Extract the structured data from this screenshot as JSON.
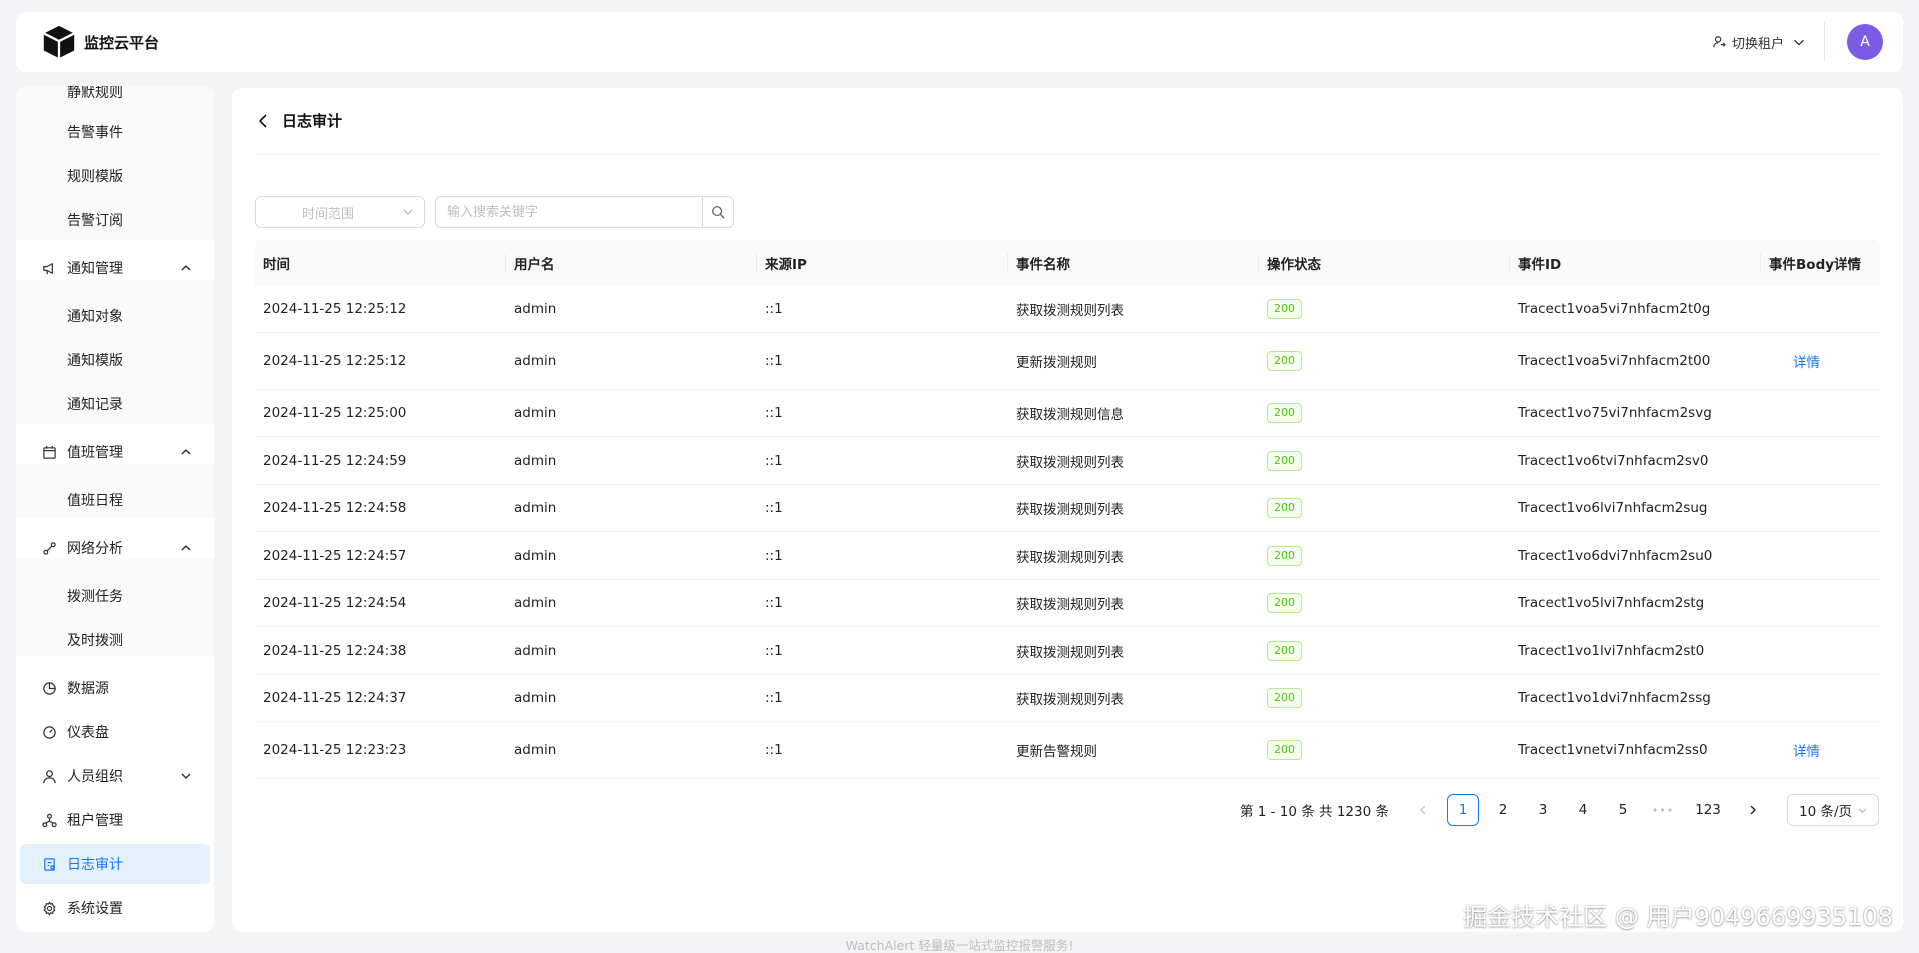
{
  "header": {
    "app_title": "监控云平台",
    "tenant_switch_label": "切换租户",
    "avatar_letter": "A"
  },
  "sidebar": {
    "items": [
      {
        "label": "静默规则",
        "level": "sub"
      },
      {
        "label": "告警事件",
        "level": "sub"
      },
      {
        "label": "规则模版",
        "level": "sub"
      },
      {
        "label": "告警订阅",
        "level": "sub"
      },
      {
        "label": "通知管理",
        "level": "group",
        "icon": "megaphone-icon",
        "expanded": true
      },
      {
        "label": "通知对象",
        "level": "sub"
      },
      {
        "label": "通知模版",
        "level": "sub"
      },
      {
        "label": "通知记录",
        "level": "sub"
      },
      {
        "label": "值班管理",
        "level": "group",
        "icon": "calendar-icon",
        "expanded": true
      },
      {
        "label": "值班日程",
        "level": "sub"
      },
      {
        "label": "网络分析",
        "level": "group",
        "icon": "network-icon",
        "expanded": true
      },
      {
        "label": "拨测任务",
        "level": "sub"
      },
      {
        "label": "及时拨测",
        "level": "sub"
      },
      {
        "label": "数据源",
        "level": "top",
        "icon": "pie-chart-icon"
      },
      {
        "label": "仪表盘",
        "level": "top",
        "icon": "dashboard-icon"
      },
      {
        "label": "人员组织",
        "level": "group",
        "icon": "user-icon",
        "expanded": false
      },
      {
        "label": "租户管理",
        "level": "top",
        "icon": "tenant-icon"
      },
      {
        "label": "日志审计",
        "level": "top",
        "icon": "audit-icon",
        "active": true
      },
      {
        "label": "系统设置",
        "level": "top",
        "icon": "settings-icon"
      }
    ]
  },
  "page": {
    "title": "日志审计"
  },
  "filters": {
    "time_range_placeholder": "时间范围",
    "search_placeholder": "输入搜索关键字"
  },
  "table": {
    "columns": [
      "时间",
      "用户名",
      "来源IP",
      "事件名称",
      "操作状态",
      "事件ID",
      "事件Body详情"
    ],
    "rows": [
      {
        "time": "2024-11-25 12:25:12",
        "user": "admin",
        "ip": "::1",
        "event": "获取拨测规则列表",
        "status": "200",
        "id": "Tracect1voa5vi7nhfacm2t0g",
        "detail": ""
      },
      {
        "time": "2024-11-25 12:25:12",
        "user": "admin",
        "ip": "::1",
        "event": "更新拨测规则",
        "status": "200",
        "id": "Tracect1voa5vi7nhfacm2t00",
        "detail": "详情"
      },
      {
        "time": "2024-11-25 12:25:00",
        "user": "admin",
        "ip": "::1",
        "event": "获取拨测规则信息",
        "status": "200",
        "id": "Tracect1vo75vi7nhfacm2svg",
        "detail": ""
      },
      {
        "time": "2024-11-25 12:24:59",
        "user": "admin",
        "ip": "::1",
        "event": "获取拨测规则列表",
        "status": "200",
        "id": "Tracect1vo6tvi7nhfacm2sv0",
        "detail": ""
      },
      {
        "time": "2024-11-25 12:24:58",
        "user": "admin",
        "ip": "::1",
        "event": "获取拨测规则列表",
        "status": "200",
        "id": "Tracect1vo6lvi7nhfacm2sug",
        "detail": ""
      },
      {
        "time": "2024-11-25 12:24:57",
        "user": "admin",
        "ip": "::1",
        "event": "获取拨测规则列表",
        "status": "200",
        "id": "Tracect1vo6dvi7nhfacm2su0",
        "detail": ""
      },
      {
        "time": "2024-11-25 12:24:54",
        "user": "admin",
        "ip": "::1",
        "event": "获取拨测规则列表",
        "status": "200",
        "id": "Tracect1vo5lvi7nhfacm2stg",
        "detail": ""
      },
      {
        "time": "2024-11-25 12:24:38",
        "user": "admin",
        "ip": "::1",
        "event": "获取拨测规则列表",
        "status": "200",
        "id": "Tracect1vo1lvi7nhfacm2st0",
        "detail": ""
      },
      {
        "time": "2024-11-25 12:24:37",
        "user": "admin",
        "ip": "::1",
        "event": "获取拨测规则列表",
        "status": "200",
        "id": "Tracect1vo1dvi7nhfacm2ssg",
        "detail": ""
      },
      {
        "time": "2024-11-25 12:23:23",
        "user": "admin",
        "ip": "::1",
        "event": "更新告警规则",
        "status": "200",
        "id": "Tracect1vnetvi7nhfacm2ss0",
        "detail": "详情"
      }
    ]
  },
  "pagination": {
    "total_text": "第 1 - 10 条 共 1230 条",
    "pages": [
      "1",
      "2",
      "3",
      "4",
      "5"
    ],
    "ellipsis": "•••",
    "last_page": "123",
    "current": "1",
    "page_size": "10 条/页"
  },
  "footer": {
    "text": "WatchAlert 轻量级一站式监控报警服务!"
  },
  "watermark": {
    "text": "掘金技术社区 @ 用户9049669935108"
  },
  "colors": {
    "accent": "#1677ff",
    "avatar_bg": "#7c5ce5",
    "status_green": "#52c41a",
    "active_menu_bg": "#e6f1fe"
  }
}
